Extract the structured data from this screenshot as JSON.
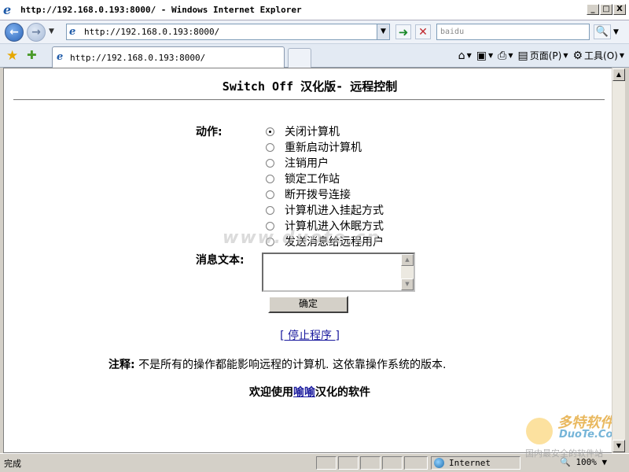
{
  "window": {
    "title": "http://192.168.0.193:8000/ - Windows Internet Explorer",
    "minimize": "_",
    "maximize": "□",
    "close": "X"
  },
  "address_bar": {
    "url": "http://192.168.0.193:8000/",
    "search_placeholder": "baidu"
  },
  "tabs": [
    {
      "label": "http://192.168.0.193:8000/"
    }
  ],
  "command_bar": {
    "page_label": "页面(P)",
    "tools_label": "工具(O)"
  },
  "page": {
    "title": "Switch Off 汉化版- 远程控制",
    "action_label": "动作:",
    "actions": [
      {
        "label": "关闭计算机",
        "checked": true
      },
      {
        "label": "重新启动计算机",
        "checked": false
      },
      {
        "label": "注销用户",
        "checked": false
      },
      {
        "label": "锁定工作站",
        "checked": false
      },
      {
        "label": "断开拨号连接",
        "checked": false
      },
      {
        "label": "计算机进入挂起方式",
        "checked": false
      },
      {
        "label": "计算机进入休眠方式",
        "checked": false
      },
      {
        "label": "发送消息给远程用户",
        "checked": false
      }
    ],
    "message_label": "消息文本:",
    "ok_button": "确定",
    "stop_link": "[ 停止程序 ]",
    "note_label": "注释:",
    "note_text": "不是所有的操作都能影响远程的计算机. 这依靠操作系统的版本.",
    "welcome_prefix": "欢迎使用",
    "welcome_link": "喻喻",
    "welcome_suffix": "汉化的软件"
  },
  "watermarks": {
    "middle": "www.duote.cn",
    "logo_cn": "多特软件站",
    "logo_en": "DuoTe.Com",
    "bottom": "国内最安全的软件站"
  },
  "status_bar": {
    "status": "完成",
    "zone": "Internet",
    "zoom": "100%"
  }
}
